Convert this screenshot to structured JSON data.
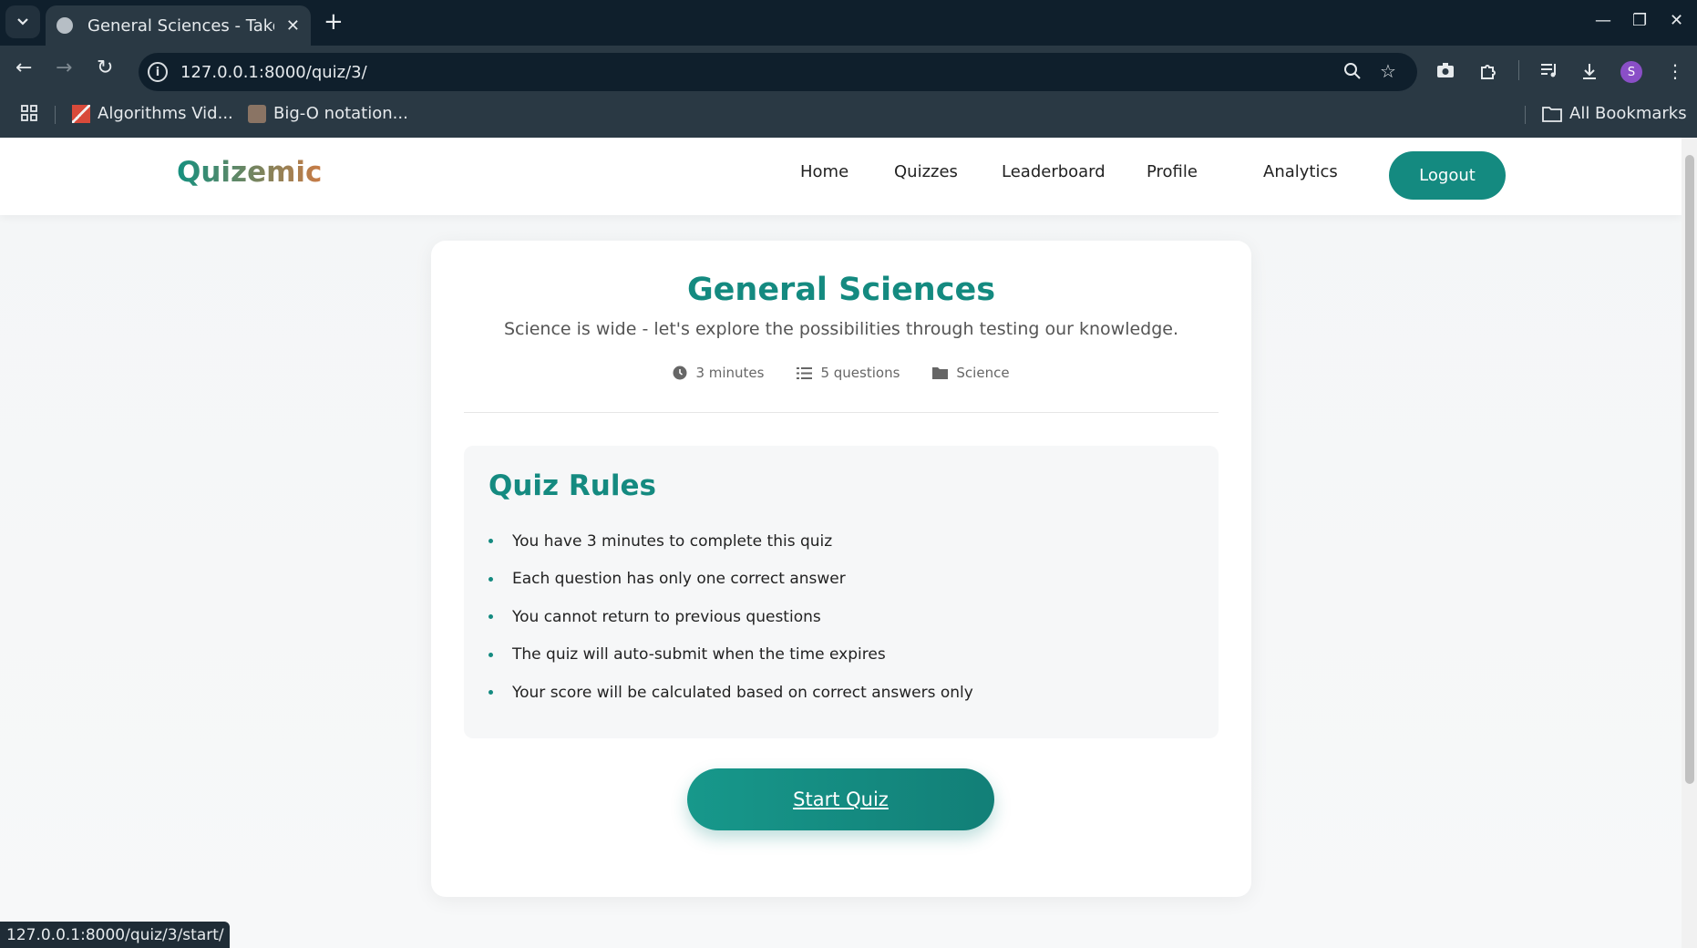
{
  "browser": {
    "tab_title": "General Sciences - Take Quiz",
    "url": "127.0.0.1:8000/quiz/3/",
    "profile_initial": "S",
    "bookmarks": [
      {
        "label": "Algorithms Vid..."
      },
      {
        "label": "Big-O notation..."
      }
    ],
    "all_bookmarks_label": "All Bookmarks",
    "status_url": "127.0.0.1:8000/quiz/3/start/"
  },
  "site": {
    "logo": "Quizemic",
    "nav": [
      "Home",
      "Quizzes",
      "Leaderboard",
      "Profile",
      "Analytics"
    ],
    "logout_label": "Logout"
  },
  "quiz": {
    "title": "General Sciences",
    "description": "Science is wide - let's explore the possibilities through testing our knowledge.",
    "meta": {
      "duration": "3 minutes",
      "questions": "5 questions",
      "category": "Science"
    },
    "rules_title": "Quiz Rules",
    "rules": [
      "You have 3 minutes to complete this quiz",
      "Each question has only one correct answer",
      "You cannot return to previous questions",
      "The quiz will auto-submit when the time expires",
      "Your score will be calculated based on correct answers only"
    ],
    "start_label": "Start Quiz"
  },
  "colors": {
    "accent": "#148a80",
    "chrome_dark": "#0f1f2c",
    "chrome_mid": "#2a3944"
  }
}
